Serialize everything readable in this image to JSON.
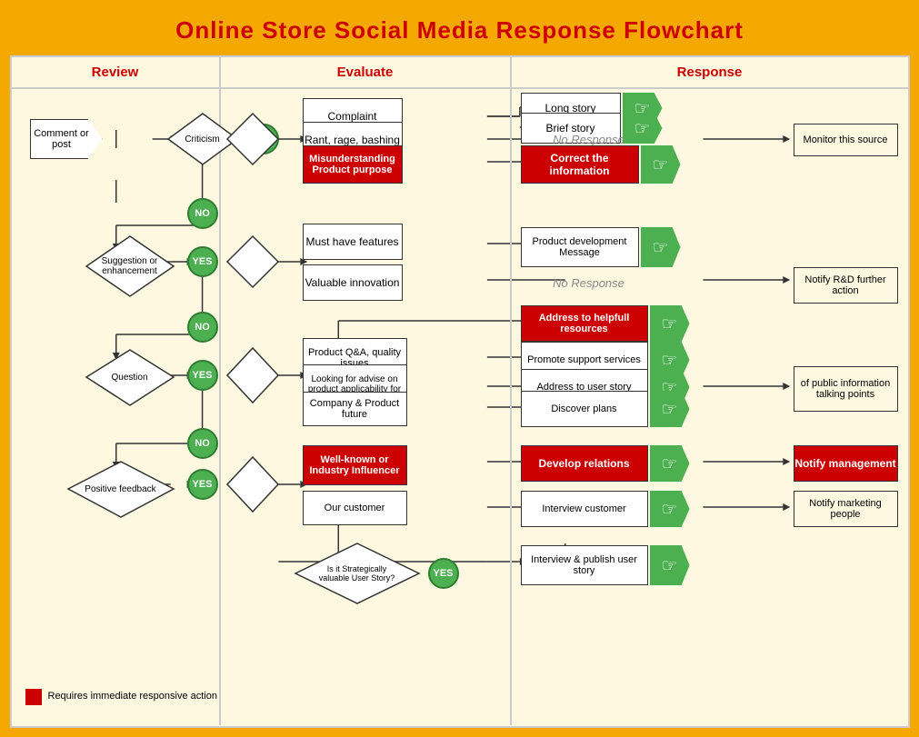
{
  "title": "Online Store Social Media Response Flowchart",
  "columns": {
    "review": "Review",
    "evaluate": "Evaluate",
    "response": "Response"
  },
  "nodes": {
    "comment_post": "Comment or post",
    "criticism": "Criticism",
    "suggestion": "Suggestion or enhancement",
    "question": "Question",
    "positive_feedback": "Positive feedback",
    "yes": "YES",
    "no": "NO",
    "complaint": "Complaint",
    "rant": "Rant, rage, bashing",
    "misunderstanding": "Misunderstanding Product purpose",
    "must_have": "Must have features",
    "valuable_innovation": "Valuable innovation",
    "product_qa": "Product Q&A, quality issues",
    "looking_advise": "Looking for advise on product applicability for proffessional tasks",
    "company_product": "Company & Product future",
    "well_known": "Well-known or Industry Influencer",
    "our_customer": "Our customer",
    "strategically": "Is it Strategically valuable User Story?",
    "long_story": "Long story",
    "brief_story": "Brief story",
    "no_response1": "No Response",
    "correct_info": "Correct the information",
    "product_dev": "Product development Message",
    "no_response2": "No Response",
    "address_helpful": "Address to helpfull resources",
    "promote_support": "Promote support services",
    "address_user": "Address to user story",
    "discover_plans": "Discover plans",
    "develop_relations": "Develop relations",
    "interview_customer": "Interview customer",
    "interview_publish": "Interview & publish user story",
    "monitor_source": "Monitor this source",
    "notify_rd": "Notify R&D further action",
    "list_public": "of public information talking points",
    "notify_management": "Notify management",
    "notify_marketing": "Notify marketing people"
  },
  "legend": "Requires immediate responsive action",
  "colors": {
    "orange": "#f5a800",
    "red": "#cc0000",
    "green": "#4caf50",
    "white": "#ffffff",
    "gray_text": "#888888"
  }
}
